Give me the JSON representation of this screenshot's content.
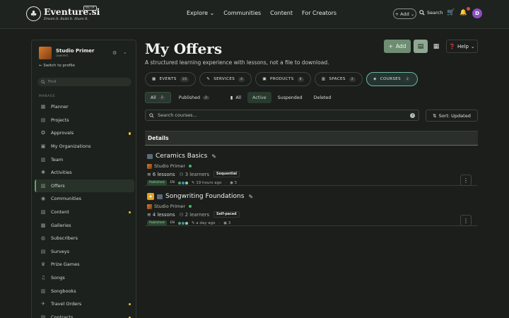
{
  "brand": {
    "name": "Eventure.si",
    "tagline": "Dream It. Build It. Share It.",
    "badge": "BETA"
  },
  "nav": {
    "explore": "Explore",
    "communities": "Communities",
    "content": "Content",
    "for_creators": "For Creators"
  },
  "topbar": {
    "add_label": "+ Add",
    "search_label": "Search",
    "avatar_initial": "D"
  },
  "sidebar": {
    "studio_name": "Studio Primer",
    "studio_sub": "(owner)",
    "switch_label": "Switch to profile",
    "filter_placeholder": "Find",
    "section_label": "MANAGE",
    "items": [
      {
        "label": "Planner",
        "icon": "calendar-icon",
        "dot": false
      },
      {
        "label": "Projects",
        "icon": "clipboard-icon",
        "dot": false
      },
      {
        "label": "Approvals",
        "icon": "approvals-icon",
        "dot": true
      },
      {
        "label": "My Organizations",
        "icon": "organization-icon",
        "dot": false
      },
      {
        "label": "Team",
        "icon": "team-icon",
        "dot": false
      },
      {
        "label": "Activities",
        "icon": "activity-icon",
        "dot": false
      },
      {
        "label": "Offers",
        "icon": "offers-icon",
        "dot": false,
        "active": true
      },
      {
        "label": "Communities",
        "icon": "communities-icon",
        "dot": false
      },
      {
        "label": "Content",
        "icon": "content-icon",
        "dot": true
      },
      {
        "label": "Galleries",
        "icon": "gallery-icon",
        "dot": false
      },
      {
        "label": "Subscribers",
        "icon": "subscribers-icon",
        "dot": false
      },
      {
        "label": "Surveys",
        "icon": "survey-icon",
        "dot": false
      },
      {
        "label": "Prize Games",
        "icon": "trophy-icon",
        "dot": false
      },
      {
        "label": "Songs",
        "icon": "music-icon",
        "dot": false
      },
      {
        "label": "Songbooks",
        "icon": "book-icon",
        "dot": false
      },
      {
        "label": "Travel Orders",
        "icon": "travel-icon",
        "dot": true
      },
      {
        "label": "Contracts",
        "icon": "contract-icon",
        "dot": true
      }
    ]
  },
  "main": {
    "title": "My Offers",
    "subtitle": "A structured learning experience with lessons, not a file to download.",
    "add_button": "Add",
    "help_button": "Help",
    "tabs": [
      {
        "label": "EVENTS",
        "count": "10",
        "icon": "calendar-icon"
      },
      {
        "label": "SERVICES",
        "count": "4",
        "icon": "services-icon"
      },
      {
        "label": "PRODUCTS",
        "count": "8",
        "icon": "product-icon"
      },
      {
        "label": "SPACES",
        "count": "2",
        "icon": "space-icon"
      },
      {
        "label": "COURSES",
        "count": "2",
        "icon": "course-icon",
        "active": true
      }
    ],
    "filters_a": [
      {
        "label": "All",
        "count": "2",
        "selected": true
      },
      {
        "label": "Published",
        "count": "2",
        "selected": false
      }
    ],
    "filters_b": [
      {
        "label": "All"
      },
      {
        "label": "Active",
        "selected": true
      },
      {
        "label": "Suspended"
      },
      {
        "label": "Deleted"
      }
    ],
    "search_placeholder": "Search courses...",
    "sort_label": "Sort: Updated",
    "table_header": "Details",
    "rows": [
      {
        "name": "Ceramics Basics",
        "owner": "Studio Primer",
        "lessons": "6 lessons",
        "learners": "3 learners",
        "mode": "Sequential",
        "status": "Published",
        "lang": "EN",
        "updated": "19 hours ago",
        "views": "5",
        "featured": false
      },
      {
        "name": "Songwriting Foundations",
        "owner": "Studio Primer",
        "lessons": "4 lessons",
        "learners": "2 learners",
        "mode": "Self-paced",
        "status": "Published",
        "lang": "EN",
        "updated": "a day ago",
        "views": "3",
        "featured": true
      }
    ]
  }
}
